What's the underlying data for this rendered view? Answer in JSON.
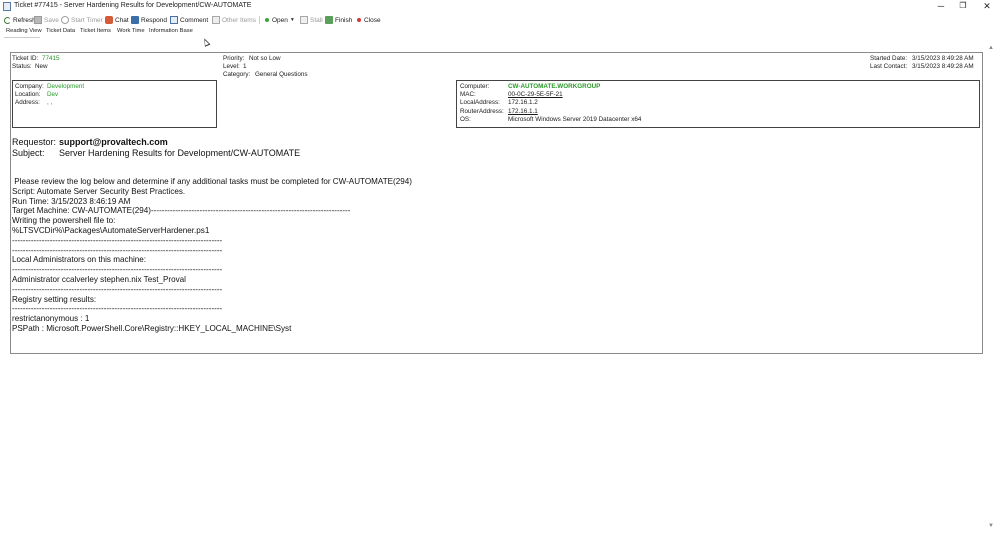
{
  "window": {
    "title": "Ticket #77415 - Server Hardening Results for Development/CW-AUTOMATE",
    "controls": {
      "minimize": "─",
      "maximize": "❐",
      "close": "✕"
    }
  },
  "toolbar": {
    "refresh": "Refresh",
    "save": "Save",
    "start_timer": "Start Timer",
    "chat": "Chat",
    "respond": "Respond",
    "comment": "Comment",
    "other_items": "Other Items",
    "open": "Open",
    "stall": "Stall",
    "finish": "Finish",
    "close": "Close"
  },
  "tabs": [
    "Reading View",
    "Ticket Data",
    "Ticket Items",
    "Work Time",
    "Information Base"
  ],
  "ticket": {
    "id_label": "Ticket ID:",
    "id": "77415",
    "status_label": "Status:",
    "status": "New",
    "priority_label": "Priority:",
    "priority": "Not so Low",
    "level_label": "Level:",
    "level": "1",
    "category_label": "Category:",
    "category": "General Questions",
    "started_label": "Started Date:",
    "started": "3/15/2023 8:49:28 AM",
    "last_contact_label": "Last Contact:",
    "last_contact": "3/15/2023 8:49:28 AM"
  },
  "company": {
    "company_label": "Company:",
    "company": "Development",
    "location_label": "Location:",
    "location": "Dev",
    "address_label": "Address:",
    "address": ", ,"
  },
  "computer": {
    "computer_label": "Computer:",
    "computer": "CW-AUTOMATE.WORKGROUP",
    "mac_label": "MAC:",
    "mac": "00-0C-29-5E-5F-21",
    "local_label": "LocalAddress:",
    "local": "172.16.1.2",
    "router_label": "RouterAddress:",
    "router": "172.16.1.1",
    "os_label": "OS:",
    "os": "Microsoft Windows Server 2019 Datacenter x64"
  },
  "request": {
    "requestor_label": "Requestor:",
    "requestor": "support@provaltech.com",
    "subject_label": "Subject:",
    "subject": "Server Hardening Results for Development/CW-AUTOMATE"
  },
  "body": " Please review the log below and determine if any additional tasks must be completed for CW-AUTOMATE(294)\nScript: Automate Server Security Best Practices.\nRun Time: 3/15/2023 8:46:19 AM\nTarget Machine: CW-AUTOMATE(294)--------------------------------------------------------------------------\nWriting the powershell file to:\n%LTSVCDir%\\Packages\\AutomateServerHardener.ps1\n------------------------------------------------------------------------------\n------------------------------------------------------------------------------\nLocal Administrators on this machine:\n------------------------------------------------------------------------------\nAdministrator ccalverley stephen.nix Test_Proval\n------------------------------------------------------------------------------\nRegistry setting results:\n------------------------------------------------------------------------------\nrestrictanonymous : 1\nPSPath : Microsoft.PowerShell.Core\\Registry::HKEY_LOCAL_MACHINE\\Syst",
  "scrollbar": {
    "up": "▲",
    "down": "▼"
  }
}
